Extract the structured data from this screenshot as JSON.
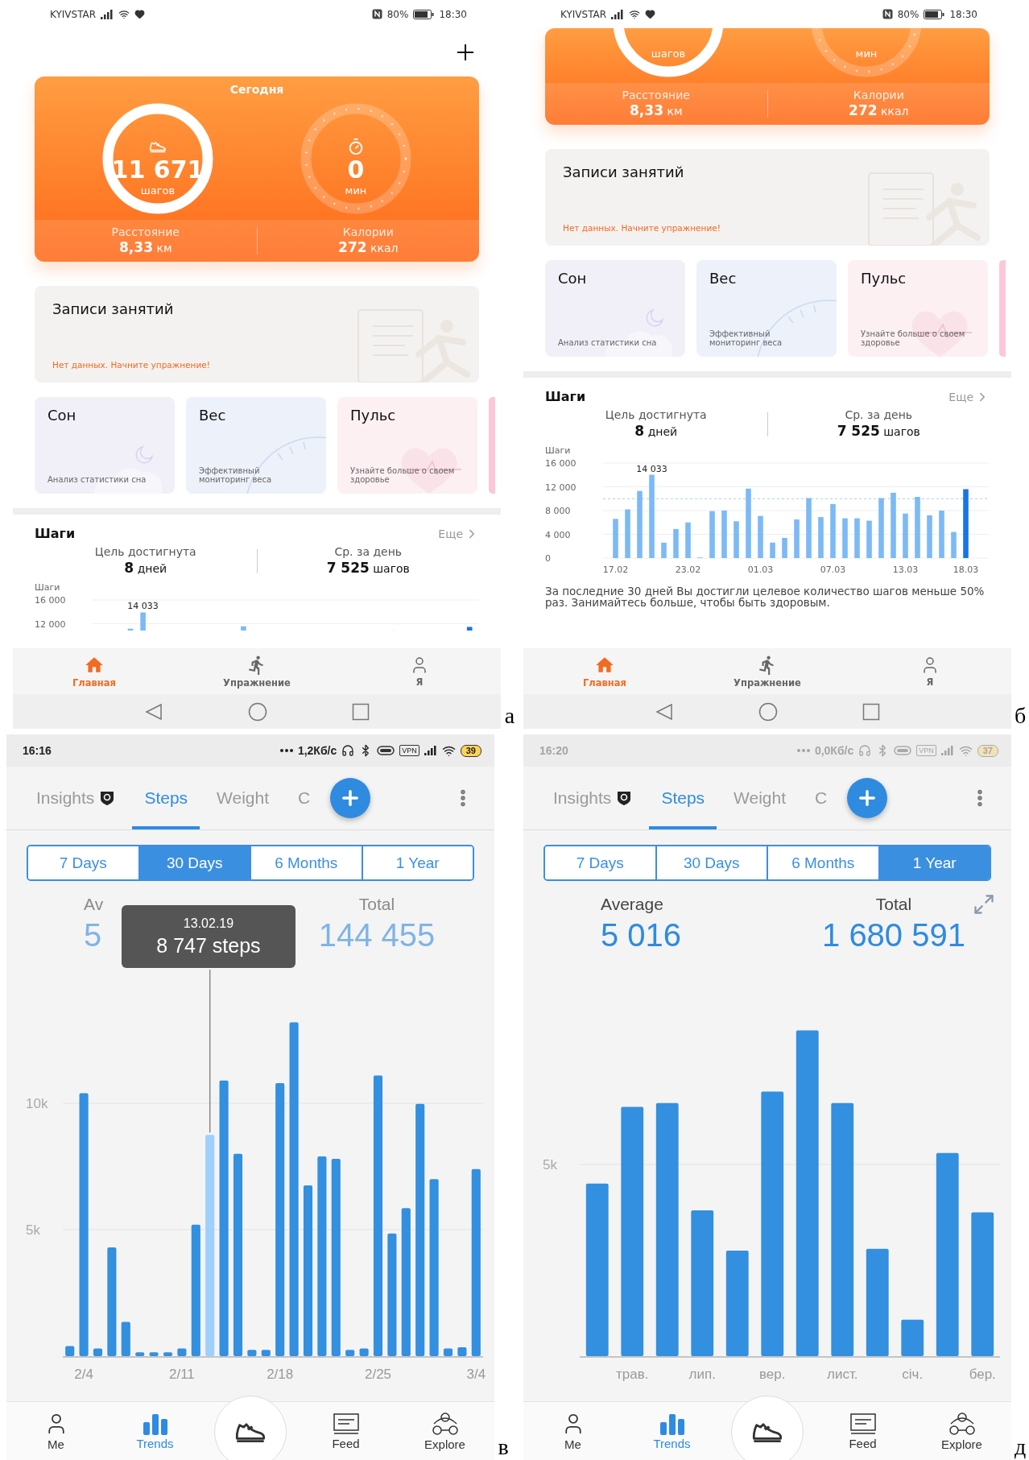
{
  "panels": [
    {
      "kind": "health",
      "letter": "а",
      "status_bar": {
        "carrier": "KYIVSTAR",
        "battery": "80%",
        "time": "18:30"
      },
      "add_button": true,
      "today": {
        "cut": false,
        "title": "Сегодня",
        "steps": "11 671",
        "steps_unit": "шагов",
        "minutes": "0",
        "minutes_unit": "мин",
        "distance_label": "Расстояние",
        "distance": "8,33",
        "distance_unit": "км",
        "calories_label": "Калории",
        "calories": "272",
        "calories_unit": "ккал"
      },
      "records": {
        "title": "Записи занятий",
        "empty": "Нет данных. Начните упражнение!"
      },
      "cards": [
        {
          "kind": "sleep",
          "title": "Сон",
          "text": "Анализ статистики сна"
        },
        {
          "kind": "weight",
          "title": "Вес",
          "text": "Эффективный мониторинг веса"
        },
        {
          "kind": "pulse",
          "title": "Пульс",
          "text": "Узнайте больше о своем здоровье"
        }
      ],
      "steps": {
        "title": "Шаги",
        "more": "Еще",
        "goal_label": "Цель достигнута",
        "goal_value": "8",
        "goal_unit": "дней",
        "avg_label": "Ср. за день",
        "avg_value": "7 525",
        "avg_unit": "шагов",
        "chart_cut": {
          "ylabel": "Шаги",
          "ticks": [
            "16 000",
            "12 000"
          ],
          "peak": "14 033"
        }
      },
      "nav": [
        {
          "kind": "home",
          "label": "Главная",
          "selected": true
        },
        {
          "kind": "exercise",
          "label": "Упражнение",
          "selected": false
        },
        {
          "kind": "me",
          "label": "Я",
          "selected": false
        }
      ]
    },
    {
      "kind": "health",
      "letter": "б",
      "status_bar": {
        "carrier": "KYIVSTAR",
        "battery": "80%",
        "time": "18:30"
      },
      "add_button": false,
      "today": {
        "cut": true,
        "steps_unit": "шагов",
        "minutes_unit": "мин",
        "distance_label": "Расстояние",
        "distance": "8,33",
        "distance_unit": "км",
        "calories_label": "Калории",
        "calories": "272",
        "calories_unit": "ккал"
      },
      "records": {
        "title": "Записи занятий",
        "empty": "Нет данных. Начните упражнение!"
      },
      "cards": [
        {
          "kind": "sleep",
          "title": "Сон",
          "text": "Анализ статистики сна"
        },
        {
          "kind": "weight",
          "title": "Вес",
          "text": "Эффективный мониторинг веса"
        },
        {
          "kind": "pulse",
          "title": "Пульс",
          "text": "Узнайте больше о своем здоровье"
        }
      ],
      "steps": {
        "title": "Шаги",
        "more": "Еще",
        "goal_label": "Цель достигнута",
        "goal_value": "8",
        "goal_unit": "дней",
        "avg_label": "Ср. за день",
        "avg_value": "7 525",
        "avg_unit": "шагов",
        "chart_data": {
          "type": "bar",
          "ylabel": "Шаги",
          "grid": true,
          "ylim": [
            0,
            16000
          ],
          "categories": [
            "17.02",
            null,
            null,
            null,
            null,
            null,
            "23.02",
            null,
            null,
            null,
            null,
            null,
            "01.03",
            null,
            null,
            null,
            null,
            null,
            "07.03",
            null,
            null,
            null,
            null,
            null,
            "13.03",
            null,
            null,
            null,
            null,
            "18.03"
          ],
          "series": [
            {
              "color": "#7cbaf6",
              "values": [
                6600,
                8200,
                11300,
                14033,
                2600,
                4900,
                6000,
                100,
                7900,
                8000,
                6200,
                11700,
                7100,
                2600,
                3400,
                6500,
                10100,
                6900,
                9100,
                6700,
                6700,
                6300,
                10100,
                11000,
                7500,
                10300,
                7200,
                8000,
                4400,
                null
              ]
            },
            {
              "color": "#1a74e6",
              "values": [
                null,
                null,
                null,
                null,
                null,
                null,
                null,
                null,
                null,
                null,
                null,
                null,
                null,
                null,
                null,
                null,
                null,
                null,
                null,
                null,
                null,
                null,
                null,
                null,
                null,
                null,
                null,
                null,
                null,
                11600
              ]
            }
          ],
          "yticks": [
            0,
            {
              "value": 4000,
              "label": "4 000"
            },
            {
              "value": 8000,
              "label": "8 000"
            },
            {
              "value": 12000,
              "label": "12 000"
            },
            {
              "value": 16000,
              "label": "16 000"
            }
          ],
          "ref_lines": [
            {
              "axis": "y",
              "value": 10000
            }
          ],
          "annotations": [
            {
              "text": "14 033",
              "y": 14033
            }
          ]
        },
        "note": "За последние 30 дней Вы достигли целевое количество шагов меньше 50% раз. Занимайтесь больше, чтобы быть здоровым."
      },
      "nav": [
        {
          "kind": "home",
          "label": "Главная",
          "selected": true
        },
        {
          "kind": "exercise",
          "label": "Упражнение",
          "selected": false
        },
        {
          "kind": "me",
          "label": "Я",
          "selected": false
        }
      ]
    },
    {
      "kind": "fit",
      "letter": "в",
      "status_bar": {
        "time": "16:16",
        "speed": "1,2Кб/с",
        "vpn": "VPN",
        "battery": "39",
        "dimmed": false
      },
      "tabs": [
        {
          "kind": "insights",
          "label": "Insights",
          "selected": false
        },
        {
          "kind": "plain",
          "label": "Steps",
          "selected": true
        },
        {
          "kind": "plain",
          "label": "Weight",
          "selected": false
        },
        {
          "kind": "plain",
          "label": "C",
          "selected": false
        }
      ],
      "ranges": [
        {
          "label": "7 Days",
          "selected": false
        },
        {
          "label": "30 Days",
          "selected": true
        },
        {
          "label": "6 Months",
          "selected": false
        },
        {
          "label": "1 Year",
          "selected": false
        }
      ],
      "stats": {
        "faded": true,
        "expand": false,
        "average_label": "Av",
        "average": "5",
        "total_label": "Total",
        "total": "144 455"
      },
      "tooltip": {
        "date": "13.02.19",
        "value": "8 747 steps"
      },
      "chart_picture": {
        "kind": "days",
        "y_labels": [
          "10k",
          "5k"
        ],
        "x_labels": [
          "2/4",
          "2/11",
          "2/18",
          "2/25",
          "3/4"
        ]
      },
      "nav": [
        {
          "kind": "me",
          "label": "Me",
          "selected": false
        },
        {
          "kind": "trends",
          "label": "Trends",
          "selected": true
        },
        {
          "kind": "start",
          "selected": false
        },
        {
          "kind": "feed",
          "label": "Feed",
          "selected": false
        },
        {
          "kind": "explore",
          "label": "Explore",
          "selected": false
        }
      ]
    },
    {
      "kind": "fit",
      "letter": "д",
      "status_bar": {
        "time": "16:20",
        "speed": "0,0Кб/с",
        "vpn": "VPN",
        "battery": "37",
        "dimmed": true
      },
      "tabs": [
        {
          "kind": "insights",
          "label": "Insights",
          "selected": false
        },
        {
          "kind": "plain",
          "label": "Steps",
          "selected": true
        },
        {
          "kind": "plain",
          "label": "Weight",
          "selected": false
        },
        {
          "kind": "plain",
          "label": "C",
          "selected": false
        }
      ],
      "ranges": [
        {
          "label": "7 Days",
          "selected": false
        },
        {
          "label": "30 Days",
          "selected": false
        },
        {
          "label": "6 Months",
          "selected": false
        },
        {
          "label": "1 Year",
          "selected": true
        }
      ],
      "stats": {
        "faded": false,
        "expand": true,
        "average_label": "Average",
        "average": "5 016",
        "total_label": "Total",
        "total": "1 680 591"
      },
      "chart_picture": {
        "kind": "months",
        "y_labels": [
          "5k"
        ],
        "x_labels": [
          "трав.",
          "лип.",
          "вер.",
          "лист.",
          "січ.",
          "бер."
        ]
      },
      "nav": [
        {
          "kind": "me",
          "label": "Me",
          "selected": false
        },
        {
          "kind": "trends",
          "label": "Trends",
          "selected": true
        },
        {
          "kind": "start",
          "selected": false
        },
        {
          "kind": "feed",
          "label": "Feed",
          "selected": false
        },
        {
          "kind": "explore",
          "label": "Explore",
          "selected": false
        }
      ]
    }
  ]
}
